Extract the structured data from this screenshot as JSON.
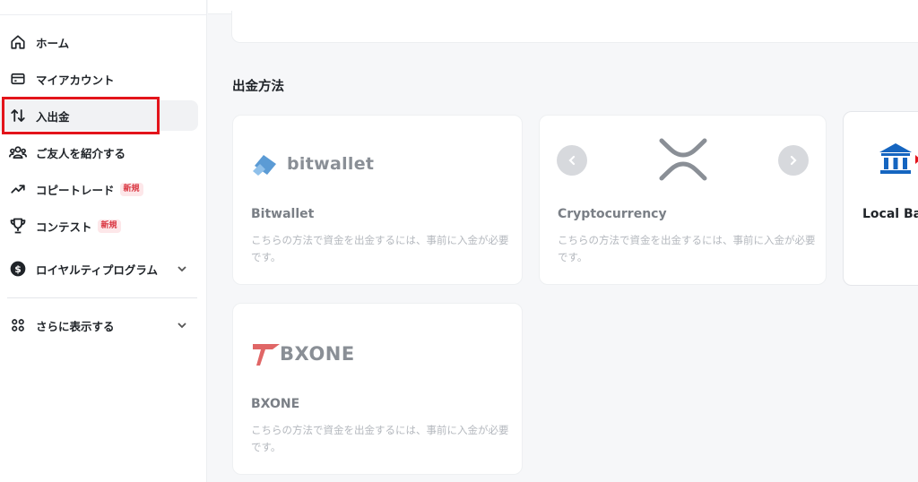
{
  "sidebar": {
    "items": [
      {
        "label": "ホーム",
        "icon": "home-icon"
      },
      {
        "label": "マイアカウント",
        "icon": "card-icon"
      },
      {
        "label": "入出金",
        "icon": "transfer-arrows-icon"
      },
      {
        "label": "ご友人を紹介する",
        "icon": "users-icon"
      },
      {
        "label": "コピートレード",
        "icon": "trending-up-icon",
        "badge": "新規"
      },
      {
        "label": "コンテスト",
        "icon": "trophy-icon",
        "badge": "新規"
      },
      {
        "label": "ロイヤルティプログラム",
        "icon": "dollar-circle-icon"
      },
      {
        "label": "さらに表示する",
        "icon": "grid-icon"
      }
    ]
  },
  "main": {
    "section_title": "出金方法",
    "methods": [
      {
        "name": "Bitwallet",
        "logo_text": "bitwallet",
        "desc": "こちらの方法で資金を出金するには、事前に入金が必要です。"
      },
      {
        "name": "Cryptocurrency",
        "desc": "こちらの方法で資金を出金するには、事前に入金が必要です。"
      },
      {
        "name": "Local Ba"
      },
      {
        "name": "BXONE",
        "logo_text": "BXONE",
        "desc": "こちらの方法で資金を出金するには、事前に入金が必要です。"
      }
    ]
  },
  "colors": {
    "highlight": "#e3141b",
    "badge_text": "#d9343f",
    "bitwallet_blue": "#5b9bd5",
    "bank_blue": "#1565c0"
  }
}
